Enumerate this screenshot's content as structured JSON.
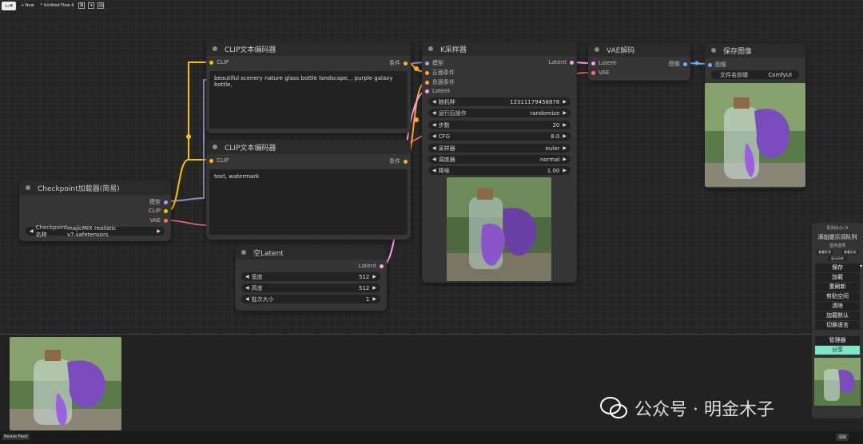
{
  "toolbar": {
    "new_label": "+ New",
    "flow_title": "* Untitled Flow 4"
  },
  "nodes": {
    "clip_pos": {
      "title": "CLIP文本编码器",
      "input_clip": "CLIP",
      "output_cond": "条件",
      "text": "beautiful scenery nature glass bottle landscape, , purple galaxy bottle,"
    },
    "clip_neg": {
      "title": "CLIP文本编码器",
      "input_clip": "CLIP",
      "output_cond": "条件",
      "text": "text, watermark"
    },
    "checkpoint": {
      "title": "Checkpoint加载器(简易)",
      "out_model": "模型",
      "out_clip": "CLIP",
      "out_vae": "VAE",
      "ckpt_label": "Checkpoint名称",
      "ckpt_value": "majicMIX realistic v7.safetensors"
    },
    "empty_latent": {
      "title": "空Latent",
      "out_latent": "Latent",
      "widgets": [
        {
          "label": "宽度",
          "value": "512"
        },
        {
          "label": "高度",
          "value": "512"
        },
        {
          "label": "批次大小",
          "value": "1"
        }
      ]
    },
    "ksampler": {
      "title": "K采样器",
      "in_model": "模型",
      "in_pos": "正面条件",
      "in_neg": "负面条件",
      "in_latent": "Latent",
      "out_latent": "Latent",
      "widgets": [
        {
          "label": "随机种",
          "value": "12311179458878"
        },
        {
          "label": "运行后操作",
          "value": "randomize"
        },
        {
          "label": "步数",
          "value": "20"
        },
        {
          "label": "CFG",
          "value": "8.0"
        },
        {
          "label": "采样器",
          "value": "euler"
        },
        {
          "label": "调度器",
          "value": "normal"
        },
        {
          "label": "降噪",
          "value": "1.00"
        }
      ]
    },
    "vae_decode": {
      "title": "VAE解码",
      "in_latent": "Latent",
      "in_vae": "VAE",
      "out_image": "图像"
    },
    "save_image": {
      "title": "保存图像",
      "in_image": "图像",
      "prefix_label": "文件名前缀",
      "prefix_value": "ComfyUI"
    }
  },
  "side_panel": {
    "queue_size": "队列大小: 0",
    "add_queue": "添加提示词队列",
    "extra_options": "显示选项",
    "view_queue": "查看队列",
    "view_history": "查看历史",
    "show_history": "显示历史",
    "buttons": [
      "保存",
      "加载",
      "重刷新",
      "剪贴空间",
      "清除",
      "加载默认",
      "切换语言"
    ],
    "manager": "管理器",
    "share": "分享"
  },
  "status_bar": {
    "resize_feed": "Resize Feed",
    "clear": "清除"
  },
  "watermark": {
    "text": "公众号 · 明金木子"
  },
  "colors": {
    "clip_wire": "#f7c300",
    "cond_wire": "#ffa931",
    "latent_wire": "#ff9cf9",
    "vae_wire": "#ff6e6e",
    "model_wire": "#b39ddb",
    "image_wire": "#64b5f6",
    "share_button": "#7de8c9"
  }
}
